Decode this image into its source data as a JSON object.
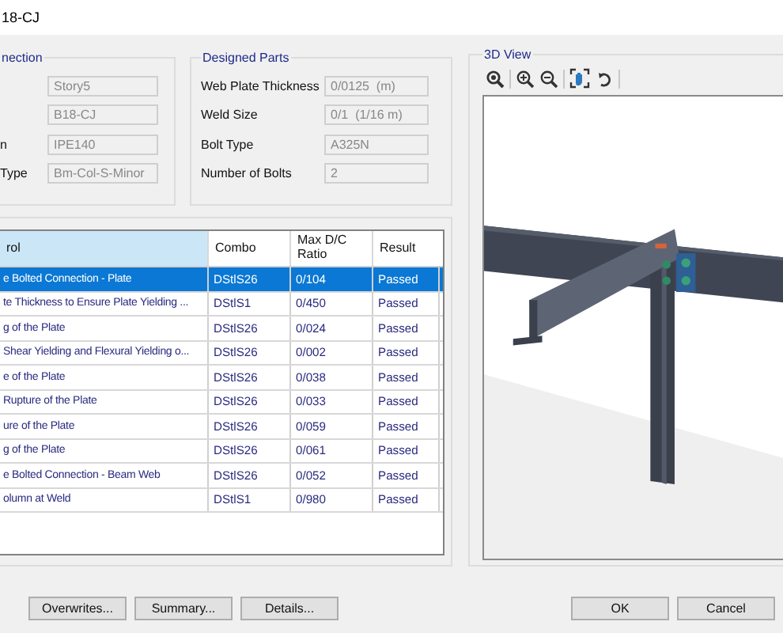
{
  "window": {
    "title": "18-CJ"
  },
  "connection": {
    "title": "nection",
    "fields": [
      {
        "value": "Story5"
      },
      {
        "value": "B18-CJ"
      },
      {
        "label": "n",
        "value": "IPE140"
      },
      {
        "label": "Type",
        "value": "Bm-Col-S-Minor"
      }
    ]
  },
  "designed_parts": {
    "title": "Designed Parts",
    "fields": [
      {
        "label": "Web Plate Thickness",
        "value": "0/0125  (m)"
      },
      {
        "label": "Weld Size",
        "value": "0/1  (1/16 m)"
      },
      {
        "label": "Bolt Type",
        "value": "A325N"
      },
      {
        "label": "Number of Bolts",
        "value": "2"
      }
    ]
  },
  "table": {
    "columns": [
      {
        "label": "rol",
        "sorted": true
      },
      {
        "label": "Combo",
        "sorted": false
      },
      {
        "label": "Max D/C Ratio",
        "sorted": false
      },
      {
        "label": "Result",
        "sorted": false
      }
    ],
    "rows": [
      {
        "cells": [
          "e Bolted Connection - Plate",
          "DStlS26",
          "0/104",
          "Passed"
        ],
        "selected": true
      },
      {
        "cells": [
          "te Thickness to Ensure Plate Yielding ...",
          "DStlS1",
          "0/450",
          "Passed"
        ],
        "selected": false
      },
      {
        "cells": [
          "g of the Plate",
          "DStlS26",
          "0/024",
          "Passed"
        ],
        "selected": false
      },
      {
        "cells": [
          "Shear Yielding and Flexural Yielding o...",
          "DStlS26",
          "0/002",
          "Passed"
        ],
        "selected": false
      },
      {
        "cells": [
          "e of the Plate",
          "DStlS26",
          "0/038",
          "Passed"
        ],
        "selected": false
      },
      {
        "cells": [
          "Rupture of the Plate",
          "DStlS26",
          "0/033",
          "Passed"
        ],
        "selected": false
      },
      {
        "cells": [
          "ure of the Plate",
          "DStlS26",
          "0/059",
          "Passed"
        ],
        "selected": false
      },
      {
        "cells": [
          "g of the Plate",
          "DStlS26",
          "0/061",
          "Passed"
        ],
        "selected": false
      },
      {
        "cells": [
          "e Bolted Connection - Beam Web",
          "DStlS26",
          "0/052",
          "Passed"
        ],
        "selected": false
      },
      {
        "cells": [
          "olumn at Weld",
          "DStlS1",
          "0/980",
          "Passed"
        ],
        "selected": false
      }
    ]
  },
  "view": {
    "title": "3D View"
  },
  "buttons_left": [
    "Overwrites...",
    "Summary...",
    "Details..."
  ],
  "buttons_right": [
    "OK",
    "Cancel"
  ]
}
